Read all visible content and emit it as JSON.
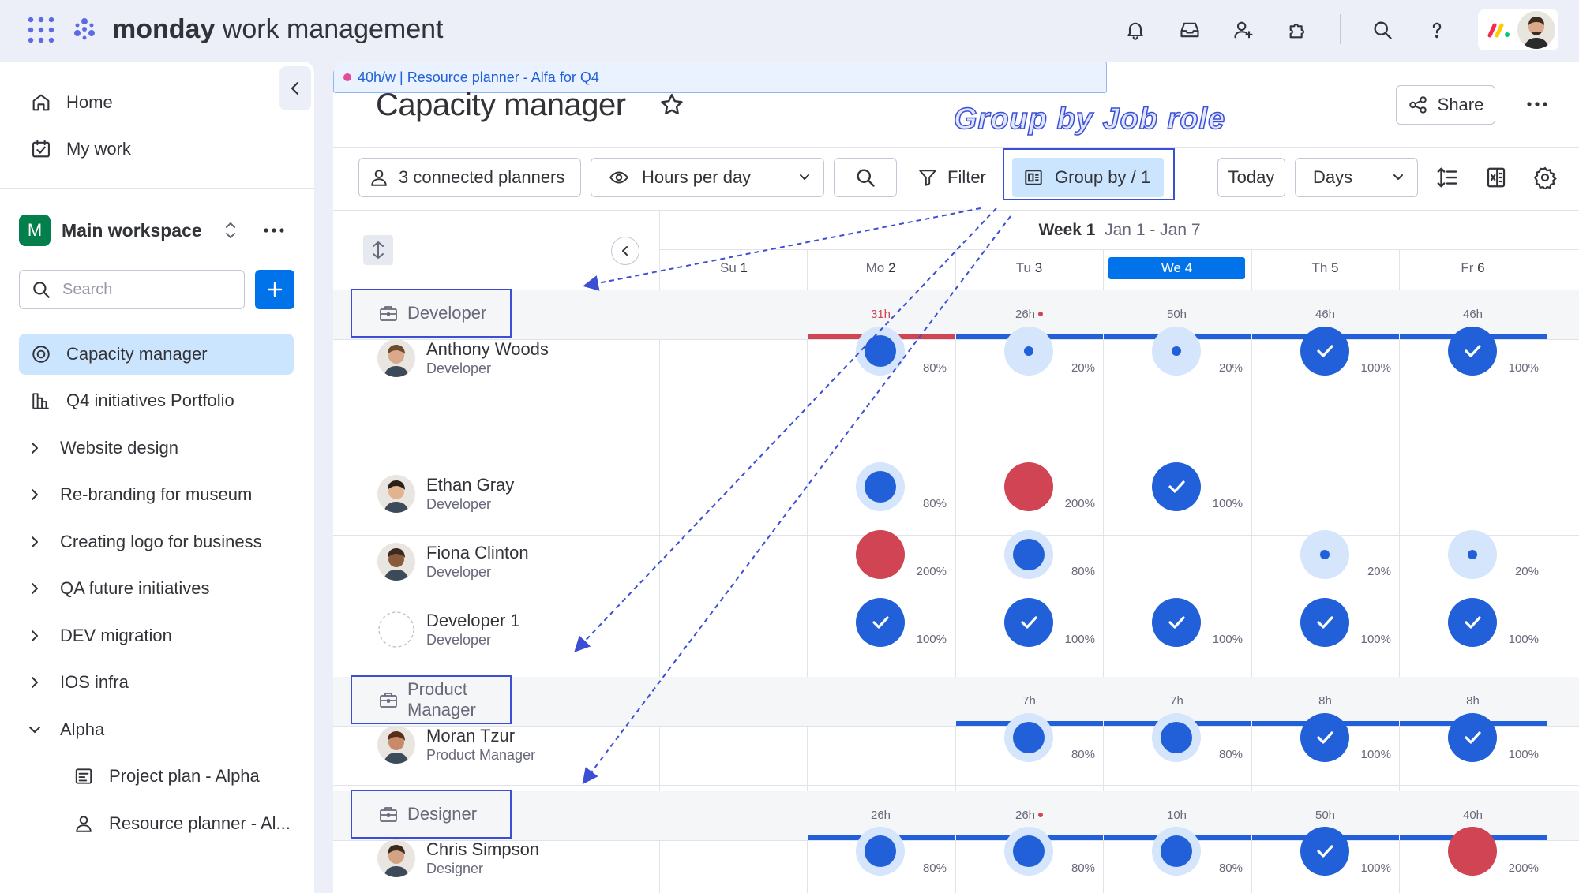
{
  "topbar": {
    "brand_bold": "monday",
    "brand_rest": " work management"
  },
  "sidebar": {
    "home": "Home",
    "my_work": "My work",
    "workspace_initial": "M",
    "workspace_name": "Main workspace",
    "search_placeholder": "Search",
    "items": [
      {
        "label": "Capacity manager"
      },
      {
        "label": "Q4 initiatives Portfolio"
      },
      {
        "label": "Website design"
      },
      {
        "label": "Re-branding for museum"
      },
      {
        "label": "Creating logo for business"
      },
      {
        "label": "QA future initiatives"
      },
      {
        "label": "DEV migration"
      },
      {
        "label": "IOS infra"
      },
      {
        "label": "Alpha"
      },
      {
        "label": "Project plan - Alpha"
      },
      {
        "label": "Resource planner - Al..."
      }
    ]
  },
  "main": {
    "title": "Capacity manager",
    "share_label": "Share",
    "annotation": "Group by Job role",
    "toolbar": {
      "planners": "3 connected planners",
      "view": "Hours per day",
      "filter": "Filter",
      "group_by": "Group by / 1",
      "today": "Today",
      "scale": "Days"
    },
    "week": {
      "label": "Week 1",
      "range": "Jan 1 - Jan 7"
    },
    "days": [
      {
        "name": "Su",
        "num": "1"
      },
      {
        "name": "Mo",
        "num": "2"
      },
      {
        "name": "Tu",
        "num": "3"
      },
      {
        "name": "We",
        "num": "4"
      },
      {
        "name": "Th",
        "num": "5"
      },
      {
        "name": "Fr",
        "num": "6"
      }
    ],
    "groups": [
      {
        "label": "Developer",
        "hours": [
          "31h",
          "26h",
          "50h",
          "46h",
          "46h"
        ]
      },
      {
        "label": "Product Manager",
        "hours": [
          "7h",
          "7h",
          "8h",
          "8h"
        ]
      },
      {
        "label": "Designer",
        "hours": [
          "26h",
          "26h",
          "10h",
          "50h",
          "40h"
        ]
      }
    ],
    "people": [
      {
        "name": "Anthony Woods",
        "role": "Developer",
        "cells": [
          "80%",
          "20%",
          "20%",
          "100%",
          "100%"
        ]
      },
      {
        "name": "Ethan Gray",
        "role": "Developer",
        "cells": [
          "80%",
          "200%",
          "100%"
        ]
      },
      {
        "name": "Fiona Clinton",
        "role": "Developer",
        "cells": [
          "200%",
          "80%",
          "20%",
          "20%"
        ]
      },
      {
        "name": "Developer 1",
        "role": "Developer",
        "cells": [
          "100%",
          "100%",
          "100%",
          "100%",
          "100%"
        ]
      },
      {
        "name": "Moran Tzur",
        "role": "Product Manager",
        "cells": [
          "80%",
          "80%",
          "100%",
          "100%"
        ]
      },
      {
        "name": "Chris Simpson",
        "role": "Designer",
        "cells": [
          "80%",
          "80%",
          "80%",
          "100%",
          "200%"
        ]
      }
    ],
    "assignment": "40h/w | Resource planner - Alfa for Q4"
  },
  "colors": {
    "primary": "#0073ea",
    "full": "#2160d8",
    "over": "#d04453",
    "light": "#d4e5fc",
    "annotation": "#3c4fd4"
  },
  "icons": [
    "apps-grid-icon",
    "monday-logo-icon",
    "bell-icon",
    "inbox-icon",
    "invite-user-icon",
    "puzzle-icon",
    "search-icon",
    "help-icon",
    "monday-mark-icon",
    "home-icon",
    "my-work-icon",
    "workspace-switch-icon",
    "more-icon",
    "plus-icon",
    "capacity-icon",
    "portfolio-icon",
    "chevron-right-icon",
    "chevron-down-icon",
    "board-icon",
    "resource-icon",
    "star-icon",
    "share-icon",
    "person-icon",
    "eye-icon",
    "filter-icon",
    "group-icon",
    "row-height-icon",
    "excel-icon",
    "settings-icon",
    "collapse-icon",
    "sort-icon",
    "briefcase-icon",
    "check-icon"
  ]
}
